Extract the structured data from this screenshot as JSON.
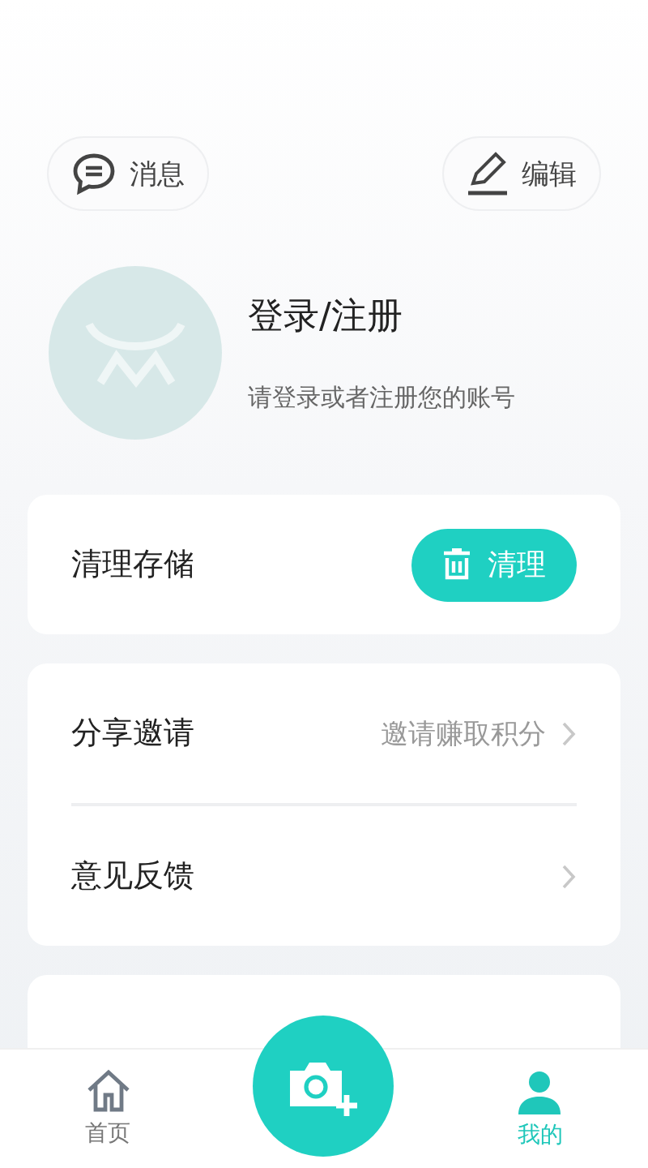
{
  "header": {
    "messages": "消息",
    "edit": "编辑"
  },
  "profile": {
    "title": "登录/注册",
    "subtitle": "请登录或者注册您的账号"
  },
  "storage": {
    "label": "清理存储",
    "button": "清理"
  },
  "menu_groups": [
    [
      {
        "label": "分享邀请",
        "hint": "邀请赚取积分"
      },
      {
        "label": "意见反馈"
      }
    ]
  ],
  "tab_bar": [
    {
      "label": "首页",
      "kind": "home",
      "selected": false
    },
    {
      "kind": "camera",
      "selected": false
    },
    {
      "label": "我的",
      "kind": "me",
      "selected": true
    }
  ]
}
